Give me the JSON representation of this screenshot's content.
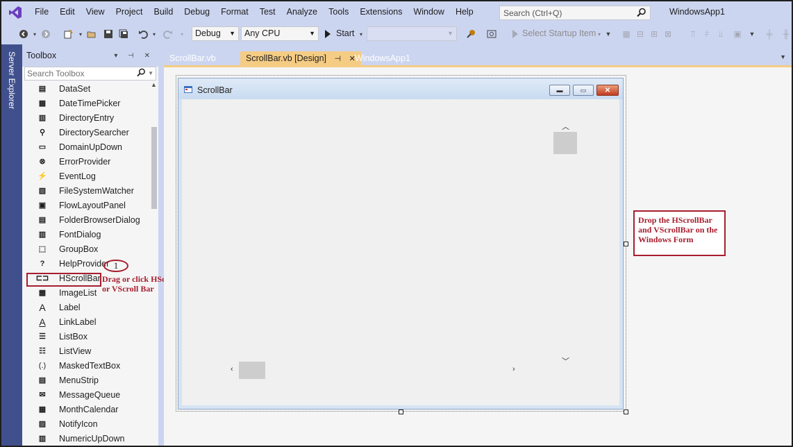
{
  "menubar": {
    "items": [
      "File",
      "Edit",
      "View",
      "Project",
      "Build",
      "Debug",
      "Format",
      "Test",
      "Analyze",
      "Tools",
      "Extensions",
      "Window",
      "Help"
    ],
    "search_placeholder": "Search (Ctrl+Q)",
    "app_name": "WindowsApp1"
  },
  "toolbar": {
    "config": "Debug",
    "platform": "Any CPU",
    "start_label": "Start",
    "startup_item": "Select Startup Item"
  },
  "server_explorer": {
    "label": "Server Explorer"
  },
  "toolbox": {
    "title": "Toolbox",
    "search_placeholder": "Search Toolbox",
    "items": [
      {
        "label": "DataSet",
        "icon": "dataset-icon"
      },
      {
        "label": "DateTimePicker",
        "icon": "datetimepicker-icon"
      },
      {
        "label": "DirectoryEntry",
        "icon": "directoryentry-icon"
      },
      {
        "label": "DirectorySearcher",
        "icon": "directorysearcher-icon"
      },
      {
        "label": "DomainUpDown",
        "icon": "domainupdown-icon"
      },
      {
        "label": "ErrorProvider",
        "icon": "errorprovider-icon"
      },
      {
        "label": "EventLog",
        "icon": "eventlog-icon"
      },
      {
        "label": "FileSystemWatcher",
        "icon": "filesystemwatcher-icon"
      },
      {
        "label": "FlowLayoutPanel",
        "icon": "flowlayoutpanel-icon"
      },
      {
        "label": "FolderBrowserDialog",
        "icon": "folderbrowserdialog-icon"
      },
      {
        "label": "FontDialog",
        "icon": "fontdialog-icon"
      },
      {
        "label": "GroupBox",
        "icon": "groupbox-icon"
      },
      {
        "label": "HelpProvider",
        "icon": "helpprovider-icon"
      },
      {
        "label": "HScrollBar",
        "icon": "hscrollbar-icon"
      },
      {
        "label": "ImageList",
        "icon": "imagelist-icon"
      },
      {
        "label": "Label",
        "icon": "label-icon"
      },
      {
        "label": "LinkLabel",
        "icon": "linklabel-icon"
      },
      {
        "label": "ListBox",
        "icon": "listbox-icon"
      },
      {
        "label": "ListView",
        "icon": "listview-icon"
      },
      {
        "label": "MaskedTextBox",
        "icon": "maskedtextbox-icon"
      },
      {
        "label": "MenuStrip",
        "icon": "menustrip-icon"
      },
      {
        "label": "MessageQueue",
        "icon": "messagequeue-icon"
      },
      {
        "label": "MonthCalendar",
        "icon": "monthcalendar-icon"
      },
      {
        "label": "NotifyIcon",
        "icon": "notifyicon-icon"
      },
      {
        "label": "NumericUpDown",
        "icon": "numericupdown-icon"
      }
    ]
  },
  "tabs": [
    {
      "label": "ScrollBar.vb",
      "active": false
    },
    {
      "label": "ScrollBar.vb [Design]",
      "active": true
    },
    {
      "label": "WindowsApp1",
      "active": false
    }
  ],
  "form": {
    "title": "ScrollBar"
  },
  "annotations": {
    "step_number": "1",
    "drag_note": "Drag or click HScroll or VScroll Bar",
    "drop_note": "Drop the HScrollBar and VScrollBar on the Windows Form"
  },
  "colors": {
    "chrome": "#ccd5f0",
    "server_strip": "#40508d",
    "active_tab": "#f5cc84",
    "annotation": "#a61e2e"
  }
}
